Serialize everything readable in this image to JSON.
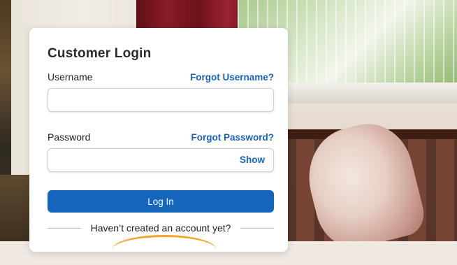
{
  "login": {
    "title": "Customer Login",
    "username_label": "Username",
    "forgot_username": "Forgot Username?",
    "username_value": "",
    "password_label": "Password",
    "forgot_password": "Forgot Password?",
    "password_value": "",
    "show_label": "Show",
    "login_button": "Log In",
    "create_account_prompt": "Haven’t created an account yet?"
  },
  "colors": {
    "link": "#1d63b5",
    "primary_button": "#1565bb",
    "highlight_arc": "#f1a42b"
  }
}
